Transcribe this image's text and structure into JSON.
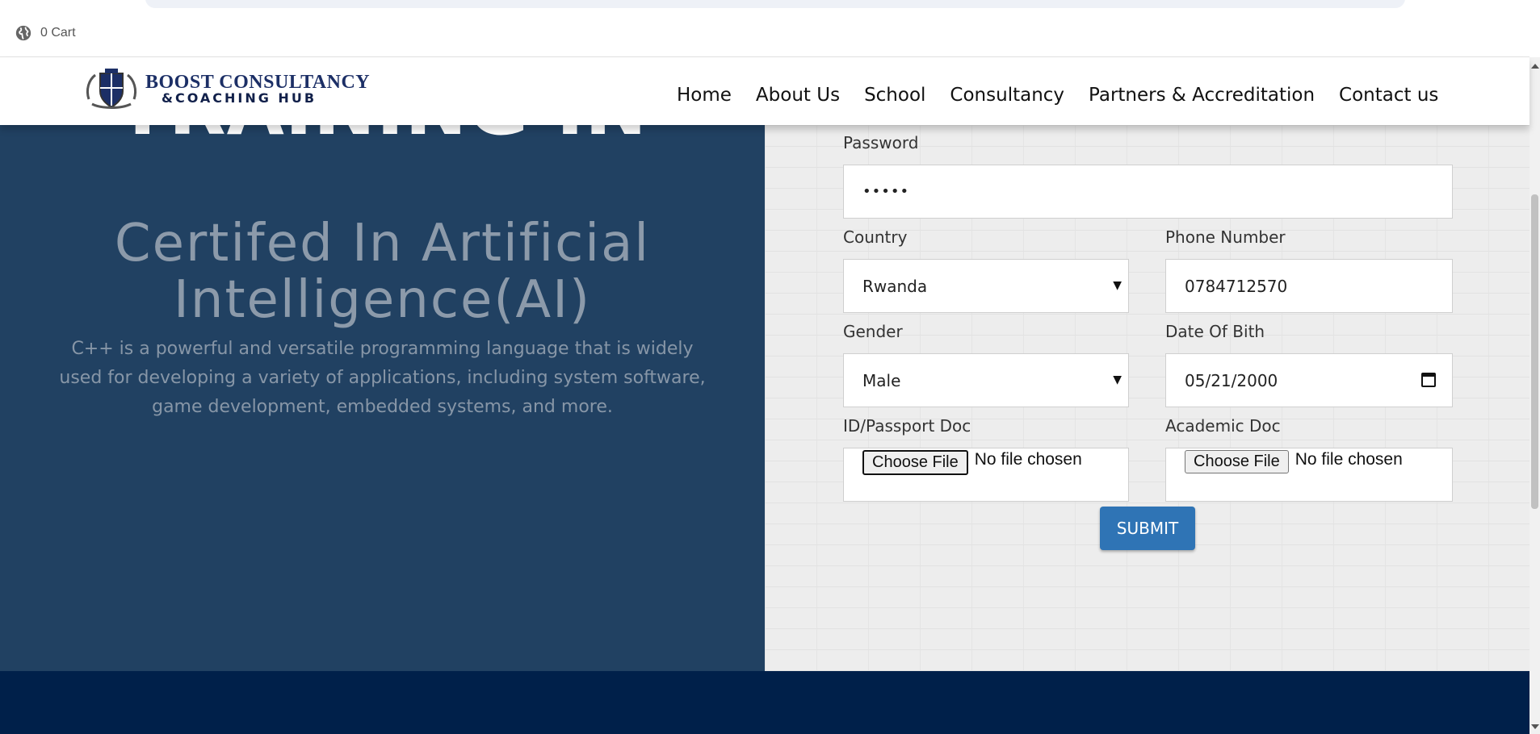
{
  "topbar": {
    "cart_label": "0 Cart",
    "cart_icon": "globe-icon"
  },
  "header": {
    "logo_line1": "BOOST CONSULTANCY",
    "logo_line2": "&COACHING HUB",
    "nav": [
      "Home",
      "About Us",
      "School",
      "Consultancy",
      "Partners & Accreditation",
      "Contact us"
    ]
  },
  "hero": {
    "heading": "TRAINING IN",
    "subheading": "Certifed In Artificial Intelligence(AI)",
    "description": "C++ is a powerful and versatile programming language that is widely used for developing a variety of applications, including system software, game development, embedded systems, and more."
  },
  "form": {
    "password_label": "Password",
    "password_value": "•••••",
    "country_label": "Country",
    "country_value": "Rwanda",
    "phone_label": "Phone Number",
    "phone_value": "0784712570",
    "gender_label": "Gender",
    "gender_value": "Male",
    "dob_label": "Date Of Bith",
    "dob_value": "05/21/2000",
    "id_doc_label": "ID/Passport Doc",
    "academic_doc_label": "Academic Doc",
    "choose_file_label": "Choose File",
    "no_file_text": "No file chosen",
    "submit_label": "SUBMIT"
  },
  "colors": {
    "hero_bg": "#214162",
    "footer_bg": "#00204a",
    "submit_bg": "#2f74b5",
    "logo_navy": "#1c2f66"
  }
}
